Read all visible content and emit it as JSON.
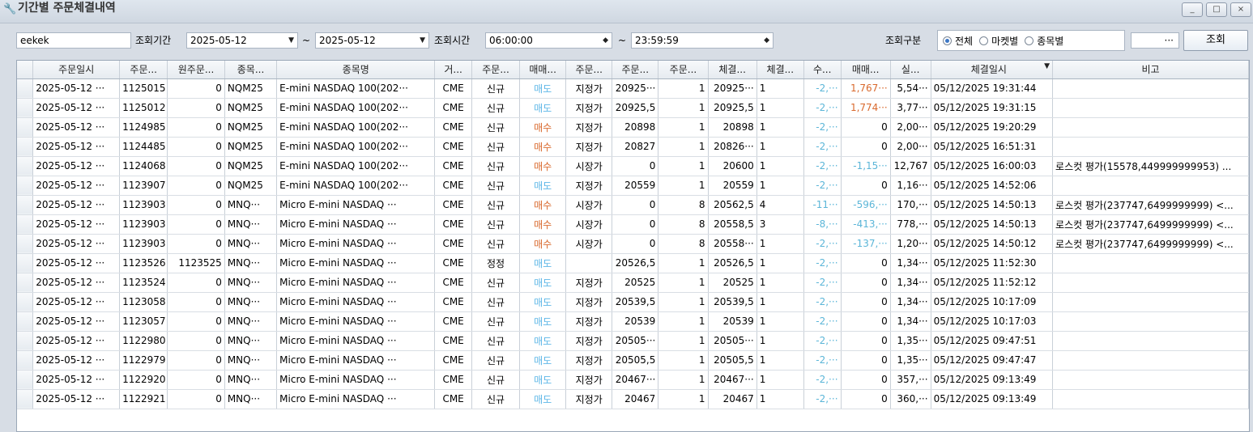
{
  "window": {
    "title": "기간별 주문체결내역",
    "buttons": [
      "_",
      "□",
      "×"
    ]
  },
  "toolbar": {
    "account": "eekek",
    "period_label": "조회기간",
    "date_from": "2025-05-12",
    "date_to": "2025-05-12",
    "tilde1": "~",
    "time_label": "조회시간",
    "time_from": "06:00:00",
    "time_to": "23:59:59",
    "tilde2": "~",
    "type_label": "조회구분",
    "radio_all": "전체",
    "radio_market": "마켓별",
    "radio_symbol": "종목별",
    "dots": "···",
    "search_button": "조회"
  },
  "columns": [
    "주문일시",
    "주문...",
    "원주문...",
    "종목...",
    "종목명",
    "거...",
    "주문...",
    "매매...",
    "주문...",
    "주문...",
    "주문...",
    "체결...",
    "체결...",
    "수...",
    "매매...",
    "실...",
    "체결일시",
    "비고"
  ],
  "rows": [
    [
      "2025-05-12 ···",
      "1125015",
      "0",
      "NQM25",
      "E-mini NASDAQ 100(202···",
      "CME",
      "신규",
      "매도",
      "지정가",
      "20925···",
      "1",
      "20925···",
      "1",
      "-2,···",
      "1,767···",
      "5,54···",
      "05/12/2025 19:31:44",
      ""
    ],
    [
      "2025-05-12 ···",
      "1125012",
      "0",
      "NQM25",
      "E-mini NASDAQ 100(202···",
      "CME",
      "신규",
      "매도",
      "지정가",
      "20925,5",
      "1",
      "20925,5",
      "1",
      "-2,···",
      "1,774···",
      "3,77···",
      "05/12/2025 19:31:15",
      ""
    ],
    [
      "2025-05-12 ···",
      "1124985",
      "0",
      "NQM25",
      "E-mini NASDAQ 100(202···",
      "CME",
      "신규",
      "매수",
      "지정가",
      "20898",
      "1",
      "20898",
      "1",
      "-2,···",
      "0",
      "2,00···",
      "05/12/2025 19:20:29",
      ""
    ],
    [
      "2025-05-12 ···",
      "1124485",
      "0",
      "NQM25",
      "E-mini NASDAQ 100(202···",
      "CME",
      "신규",
      "매수",
      "지정가",
      "20827",
      "1",
      "20826···",
      "1",
      "-2,···",
      "0",
      "2,00···",
      "05/12/2025 16:51:31",
      ""
    ],
    [
      "2025-05-12 ···",
      "1124068",
      "0",
      "NQM25",
      "E-mini NASDAQ 100(202···",
      "CME",
      "신규",
      "매수",
      "시장가",
      "0",
      "1",
      "20600",
      "1",
      "-2,···",
      "-1,15···",
      "12,767",
      "05/12/2025 16:00:03",
      "로스컷 평가(15578,449999999953) ..."
    ],
    [
      "2025-05-12 ···",
      "1123907",
      "0",
      "NQM25",
      "E-mini NASDAQ 100(202···",
      "CME",
      "신규",
      "매도",
      "지정가",
      "20559",
      "1",
      "20559",
      "1",
      "-2,···",
      "0",
      "1,16···",
      "05/12/2025 14:52:06",
      ""
    ],
    [
      "2025-05-12 ···",
      "1123903",
      "0",
      "MNQ···",
      "Micro E-mini NASDAQ ···",
      "CME",
      "신규",
      "매수",
      "시장가",
      "0",
      "8",
      "20562,5",
      "4",
      "-11···",
      "-596,···",
      "170,···",
      "05/12/2025 14:50:13",
      "로스컷 평가(237747,6499999999) <..."
    ],
    [
      "2025-05-12 ···",
      "1123903",
      "0",
      "MNQ···",
      "Micro E-mini NASDAQ ···",
      "CME",
      "신규",
      "매수",
      "시장가",
      "0",
      "8",
      "20558,5",
      "3",
      "-8,···",
      "-413,···",
      "778,···",
      "05/12/2025 14:50:13",
      "로스컷 평가(237747,6499999999) <..."
    ],
    [
      "2025-05-12 ···",
      "1123903",
      "0",
      "MNQ···",
      "Micro E-mini NASDAQ ···",
      "CME",
      "신규",
      "매수",
      "시장가",
      "0",
      "8",
      "20558···",
      "1",
      "-2,···",
      "-137,···",
      "1,20···",
      "05/12/2025 14:50:12",
      "로스컷 평가(237747,6499999999) <..."
    ],
    [
      "2025-05-12 ···",
      "1123526",
      "1123525",
      "MNQ···",
      "Micro E-mini NASDAQ ···",
      "CME",
      "정정",
      "매도",
      "",
      "20526,5",
      "1",
      "20526,5",
      "1",
      "-2,···",
      "0",
      "1,34···",
      "05/12/2025 11:52:30",
      ""
    ],
    [
      "2025-05-12 ···",
      "1123524",
      "0",
      "MNQ···",
      "Micro E-mini NASDAQ ···",
      "CME",
      "신규",
      "매도",
      "지정가",
      "20525",
      "1",
      "20525",
      "1",
      "-2,···",
      "0",
      "1,34···",
      "05/12/2025 11:52:12",
      ""
    ],
    [
      "2025-05-12 ···",
      "1123058",
      "0",
      "MNQ···",
      "Micro E-mini NASDAQ ···",
      "CME",
      "신규",
      "매도",
      "지정가",
      "20539,5",
      "1",
      "20539,5",
      "1",
      "-2,···",
      "0",
      "1,34···",
      "05/12/2025 10:17:09",
      ""
    ],
    [
      "2025-05-12 ···",
      "1123057",
      "0",
      "MNQ···",
      "Micro E-mini NASDAQ ···",
      "CME",
      "신규",
      "매도",
      "지정가",
      "20539",
      "1",
      "20539",
      "1",
      "-2,···",
      "0",
      "1,34···",
      "05/12/2025 10:17:03",
      ""
    ],
    [
      "2025-05-12 ···",
      "1122980",
      "0",
      "MNQ···",
      "Micro E-mini NASDAQ ···",
      "CME",
      "신규",
      "매도",
      "지정가",
      "20505···",
      "1",
      "20505···",
      "1",
      "-2,···",
      "0",
      "1,35···",
      "05/12/2025 09:47:51",
      ""
    ],
    [
      "2025-05-12 ···",
      "1122979",
      "0",
      "MNQ···",
      "Micro E-mini NASDAQ ···",
      "CME",
      "신규",
      "매도",
      "지정가",
      "20505,5",
      "1",
      "20505,5",
      "1",
      "-2,···",
      "0",
      "1,35···",
      "05/12/2025 09:47:47",
      ""
    ],
    [
      "2025-05-12 ···",
      "1122920",
      "0",
      "MNQ···",
      "Micro E-mini NASDAQ ···",
      "CME",
      "신규",
      "매도",
      "지정가",
      "20467···",
      "1",
      "20467···",
      "1",
      "-2,···",
      "0",
      "357,···",
      "05/12/2025 09:13:49",
      ""
    ],
    [
      "2025-05-12 ···",
      "1122921",
      "0",
      "MNQ···",
      "Micro E-mini NASDAQ ···",
      "CME",
      "신규",
      "매도",
      "지정가",
      "20467",
      "1",
      "20467",
      "1",
      "-2,···",
      "0",
      "360,···",
      "05/12/2025 09:13:49",
      ""
    ]
  ],
  "colors": {
    "sell": "#5eb7e7",
    "buy": "#d9692d",
    "negative": "#5cb6d8",
    "positive": "#d9692d"
  }
}
